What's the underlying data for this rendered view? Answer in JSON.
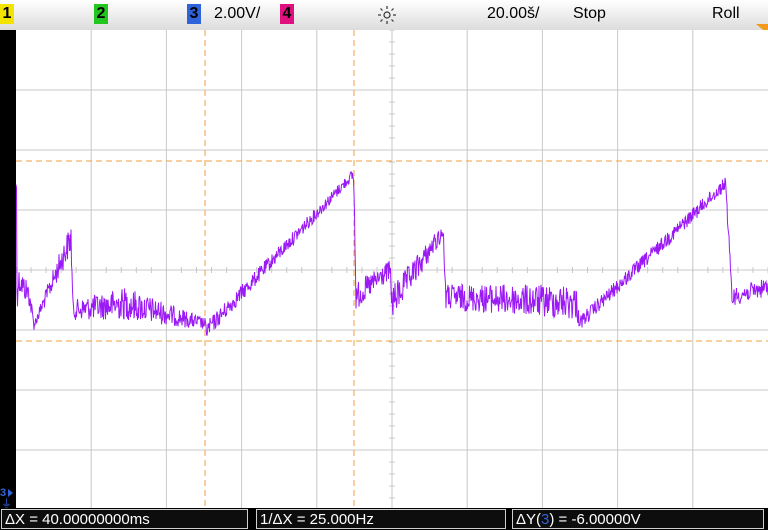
{
  "channels": [
    {
      "label": "1",
      "color": "#f2e400"
    },
    {
      "label": "2",
      "color": "#22c61e"
    },
    {
      "label": "3",
      "color": "#2f63d9"
    },
    {
      "label": "4",
      "color": "#e0117f"
    }
  ],
  "header": {
    "ch3_scale": "2.00V/",
    "trigger_icon": "trigger-sun-icon",
    "timebase": "20.00š/",
    "run_state": "Stop",
    "mode": "Roll"
  },
  "marker": {
    "ground_label": "3"
  },
  "measurements": {
    "dx": "ΔX = 40.00000000ms",
    "inv_dx": "1/ΔX = 25.000Hz",
    "dy_prefix": "ΔY(",
    "dy_channel": "3",
    "dy_suffix": ") = -6.00000V"
  },
  "colors": {
    "trace": "#9b19f5",
    "cursor": "#f0a040",
    "grid": "#c8c8c8",
    "ch3": "#2f63d9"
  }
}
